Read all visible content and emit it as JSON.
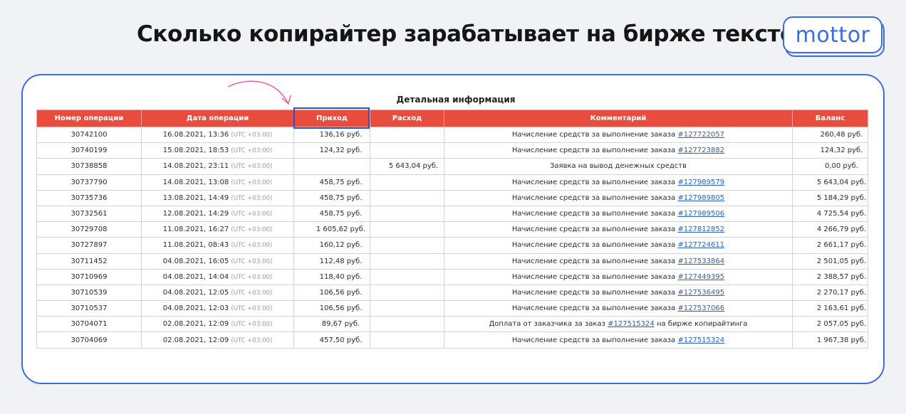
{
  "headline": "Сколько копирайтер зарабатывает на бирже текстов",
  "logo": "mottor",
  "section_title": "Детальная информация",
  "columns": [
    "Номер операции",
    "Дата операции",
    "Приход",
    "Расход",
    "Комментарий",
    "Баланс"
  ],
  "tz_label": "(UTC +03:00)",
  "comment_prefix": "Начисление средств за выполнение заказа",
  "rows": [
    {
      "id": "30742100",
      "date": "16.08.2021, 13:36",
      "income": "136,16 руб.",
      "expense": "",
      "comment": "Начисление средств за выполнение заказа",
      "order": "#127722057",
      "suffix": "",
      "balance": "260,48 руб."
    },
    {
      "id": "30740199",
      "date": "15.08.2021, 18:53",
      "income": "124,32 руб.",
      "expense": "",
      "comment": "Начисление средств за выполнение заказа",
      "order": "#127723882",
      "suffix": "",
      "balance": "124,32 руб."
    },
    {
      "id": "30738858",
      "date": "14.08.2021, 23:11",
      "income": "",
      "expense": "5 643,04 руб.",
      "comment": "Заявка на вывод денежных средств",
      "order": "",
      "suffix": "",
      "balance": "0,00 руб."
    },
    {
      "id": "30737790",
      "date": "14.08.2021, 13:08",
      "income": "458,75 руб.",
      "expense": "",
      "comment": "Начисление средств за выполнение заказа",
      "order": "#127989579",
      "suffix": "",
      "balance": "5 643,04 руб."
    },
    {
      "id": "30735736",
      "date": "13.08.2021, 14:49",
      "income": "458,75 руб.",
      "expense": "",
      "comment": "Начисление средств за выполнение заказа",
      "order": "#127989805",
      "suffix": "",
      "balance": "5 184,29 руб."
    },
    {
      "id": "30732561",
      "date": "12.08.2021, 14:29",
      "income": "458,75 руб.",
      "expense": "",
      "comment": "Начисление средств за выполнение заказа",
      "order": "#127989506",
      "suffix": "",
      "balance": "4 725,54 руб."
    },
    {
      "id": "30729708",
      "date": "11.08.2021, 16:27",
      "income": "1 605,62 руб.",
      "expense": "",
      "comment": "Начисление средств за выполнение заказа",
      "order": "#127812852",
      "suffix": "",
      "balance": "4 266,79 руб."
    },
    {
      "id": "30727897",
      "date": "11.08.2021, 08:43",
      "income": "160,12 руб.",
      "expense": "",
      "comment": "Начисление средств за выполнение заказа",
      "order": "#127724611",
      "suffix": "",
      "balance": "2 661,17 руб."
    },
    {
      "id": "30711452",
      "date": "04.08.2021, 16:05",
      "income": "112,48 руб.",
      "expense": "",
      "comment": "Начисление средств за выполнение заказа",
      "order": "#127533864",
      "suffix": "",
      "balance": "2 501,05 руб."
    },
    {
      "id": "30710969",
      "date": "04.08.2021, 14:04",
      "income": "118,40 руб.",
      "expense": "",
      "comment": "Начисление средств за выполнение заказа",
      "order": "#127449395",
      "suffix": "",
      "balance": "2 388,57 руб."
    },
    {
      "id": "30710539",
      "date": "04.08.2021, 12:05",
      "income": "106,56 руб.",
      "expense": "",
      "comment": "Начисление средств за выполнение заказа",
      "order": "#127536495",
      "suffix": "",
      "balance": "2 270,17 руб."
    },
    {
      "id": "30710537",
      "date": "04.08.2021, 12:03",
      "income": "106,56 руб.",
      "expense": "",
      "comment": "Начисление средств за выполнение заказа",
      "order": "#127537066",
      "suffix": "",
      "balance": "2 163,61 руб."
    },
    {
      "id": "30704071",
      "date": "02.08.2021, 12:09",
      "income": "89,67 руб.",
      "expense": "",
      "comment": "Доплата от заказчика за заказ",
      "order": "#127515324",
      "suffix": "на бирже копирайтинга",
      "balance": "2 057,05 руб."
    },
    {
      "id": "30704069",
      "date": "02.08.2021, 12:09",
      "income": "457,50 руб.",
      "expense": "",
      "comment": "Начисление средств за выполнение заказа",
      "order": "#127515324",
      "suffix": "",
      "balance": "1 967,38 руб."
    }
  ],
  "colors": {
    "accent": "#3d6cdf",
    "header_red": "#e84c3d",
    "link": "#2a62b8",
    "arrow_pink": "#ee5aa6"
  }
}
